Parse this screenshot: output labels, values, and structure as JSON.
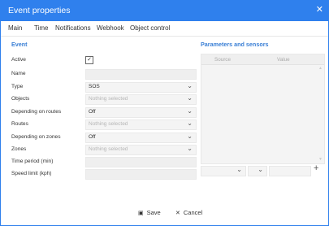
{
  "window": {
    "title": "Event properties",
    "close_glyph": "✕"
  },
  "tabs": [
    {
      "label": "Main"
    },
    {
      "label": "Time"
    },
    {
      "label": "Notifications"
    },
    {
      "label": "Webhook"
    },
    {
      "label": "Object control"
    }
  ],
  "event": {
    "section_title": "Event",
    "active_label": "Active",
    "active_checked": true,
    "name_label": "Name",
    "name_value": "",
    "type_label": "Type",
    "type_value": "SOS",
    "objects_label": "Objects",
    "objects_value": "Nothing selected",
    "depending_routes_label": "Depending on routes",
    "depending_routes_value": "Off",
    "routes_label": "Routes",
    "routes_value": "Nothing selected",
    "depending_zones_label": "Depending on zones",
    "depending_zones_value": "Off",
    "zones_label": "Zones",
    "zones_value": "Nothing selected",
    "time_period_label": "Time period (min)",
    "time_period_value": "",
    "speed_limit_label": "Speed limit (kph)",
    "speed_limit_value": ""
  },
  "params": {
    "section_title": "Parameters and sensors",
    "col_source": "Source",
    "col_value": "Value"
  },
  "footer": {
    "save_label": "Save",
    "cancel_label": "Cancel"
  },
  "icons": {
    "checkmark": "☑",
    "chevron": "⌄",
    "plus": "+",
    "save": "💾",
    "close": "✕"
  },
  "colors": {
    "accent": "#2f80ed",
    "section": "#3a7fd5"
  }
}
